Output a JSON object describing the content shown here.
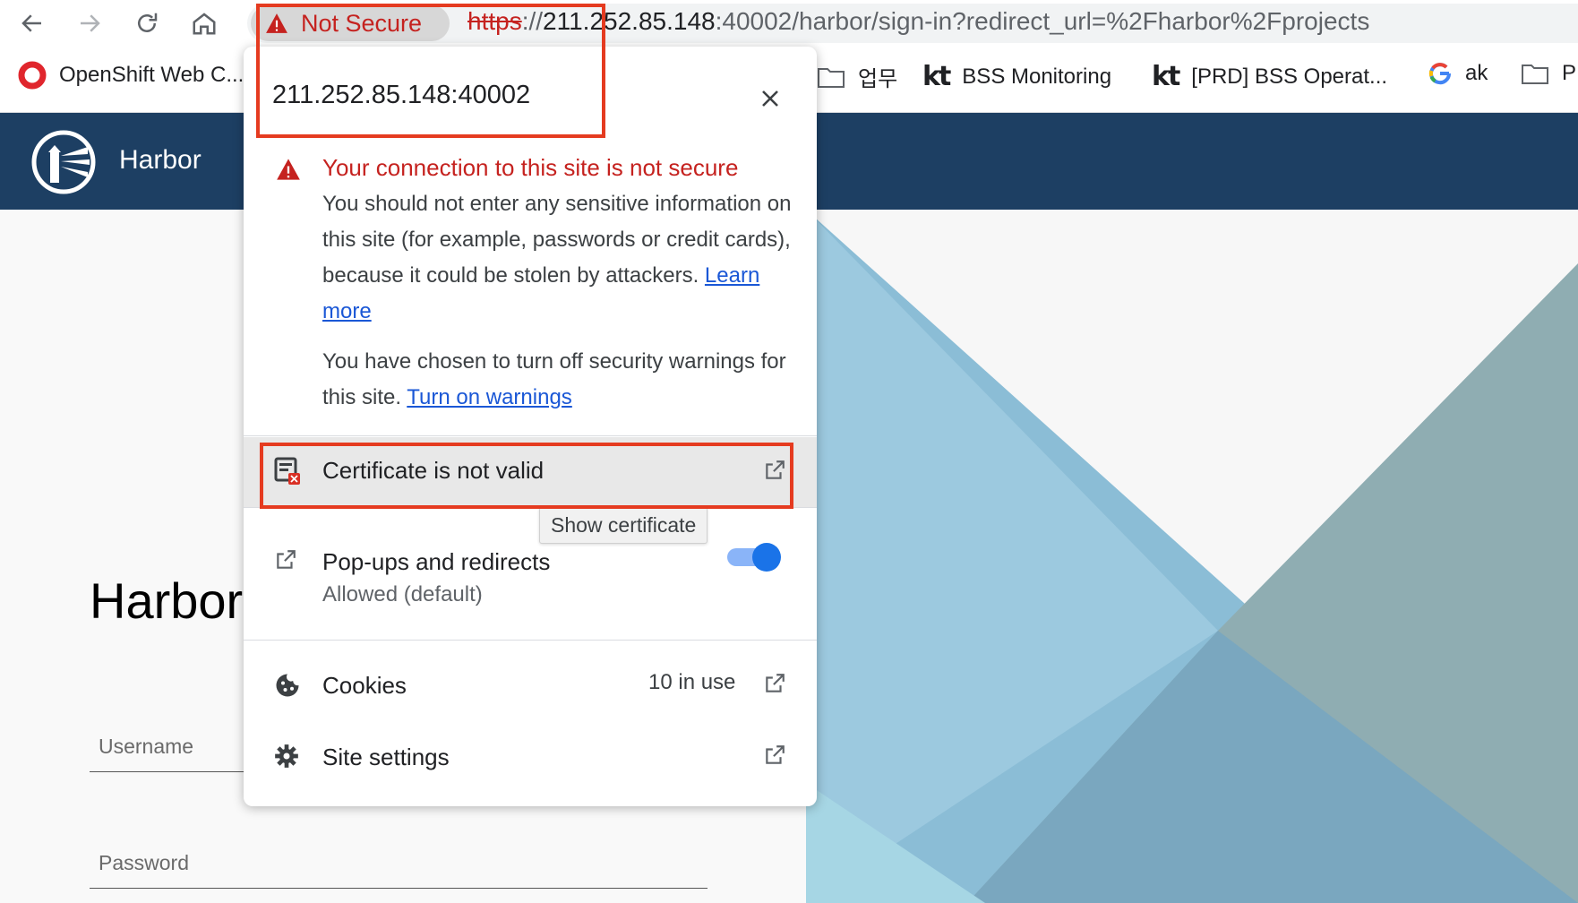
{
  "browser": {
    "chip_label": "Not Secure",
    "url_scheme": "https",
    "url_sep": "://",
    "url_host": "211.252.85.148",
    "url_rest": ":40002/harbor/sign-in?redirect_url=%2Fharbor%2Fprojects",
    "bookmarks": [
      {
        "label": "OpenShift Web C...",
        "icon": "openshift-icon"
      },
      {
        "label": "업무",
        "icon": "folder-icon"
      },
      {
        "label": "BSS Monitoring",
        "icon": "kt-icon"
      },
      {
        "label": "[PRD] BSS Operat...",
        "icon": "kt-icon"
      },
      {
        "label": "ak",
        "icon": "google-icon"
      },
      {
        "label": "P",
        "icon": "folder-icon"
      }
    ]
  },
  "app": {
    "title": "Harbor",
    "hero": "Harbor",
    "username_placeholder": "Username",
    "password_placeholder": "Password"
  },
  "popup": {
    "host": "211.252.85.148:40002",
    "warning_title": "Your connection to this site is not secure",
    "warning_body": "You should not enter any sensitive information on this site (for example, passwords or credit cards), because it could be stolen by attackers.",
    "learn_more": "Learn more",
    "warnings_off": "You have chosen to turn off security warnings for this site.",
    "turn_on_warnings": "Turn on warnings",
    "certificate": "Certificate is not valid",
    "tooltip": "Show certificate",
    "popups_label": "Pop-ups and redirects",
    "popups_sub": "Allowed (default)",
    "popups_enabled": true,
    "cookies_label": "Cookies",
    "cookies_count": "10 in use",
    "site_settings": "Site settings"
  },
  "colors": {
    "header_bg": "#1d3f63",
    "warning_red": "#c5221f",
    "link_blue": "#1a57d6",
    "highlight_red": "#e53b20",
    "toggle_blue": "#1a73e8"
  }
}
